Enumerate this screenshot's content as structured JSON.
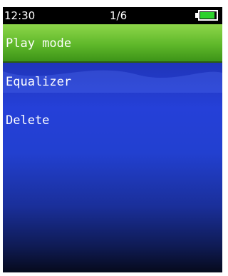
{
  "status_bar": {
    "time": "12:30",
    "page": "1/6",
    "battery_level": 0.9,
    "battery_color": "#2bd12b"
  },
  "menu": {
    "items": [
      {
        "label": "Play mode",
        "selected": true
      },
      {
        "label": "Equalizer",
        "selected": false
      },
      {
        "label": "Delete",
        "selected": false
      }
    ]
  },
  "colors": {
    "highlight": "#5fb82a",
    "background": "#2240d0"
  }
}
